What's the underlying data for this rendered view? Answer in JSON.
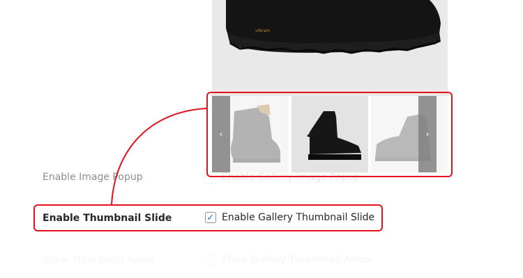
{
  "gallery": {
    "prev_arrow": "‹",
    "next_arrow": "›"
  },
  "settings": {
    "rows": [
      {
        "label": "Enable Image Popup",
        "checkbox_label": "Enable Gallery Image Popup",
        "checked": false
      },
      {
        "label": "Enable Thumbnail Slide",
        "checkbox_label": "Enable Gallery Thumbnail Slide",
        "checked": true
      },
      {
        "label": "Show Thumbnail Arrow",
        "checkbox_label": "Show Gallery Thumbnail Arrow",
        "checked": true
      }
    ],
    "check_mark": "✓"
  },
  "colors": {
    "callout": "#e3111c",
    "checkbox_tick": "#2271b1"
  },
  "icons": [
    "chevron-left-icon",
    "chevron-right-icon",
    "checkbox-checked-icon"
  ]
}
